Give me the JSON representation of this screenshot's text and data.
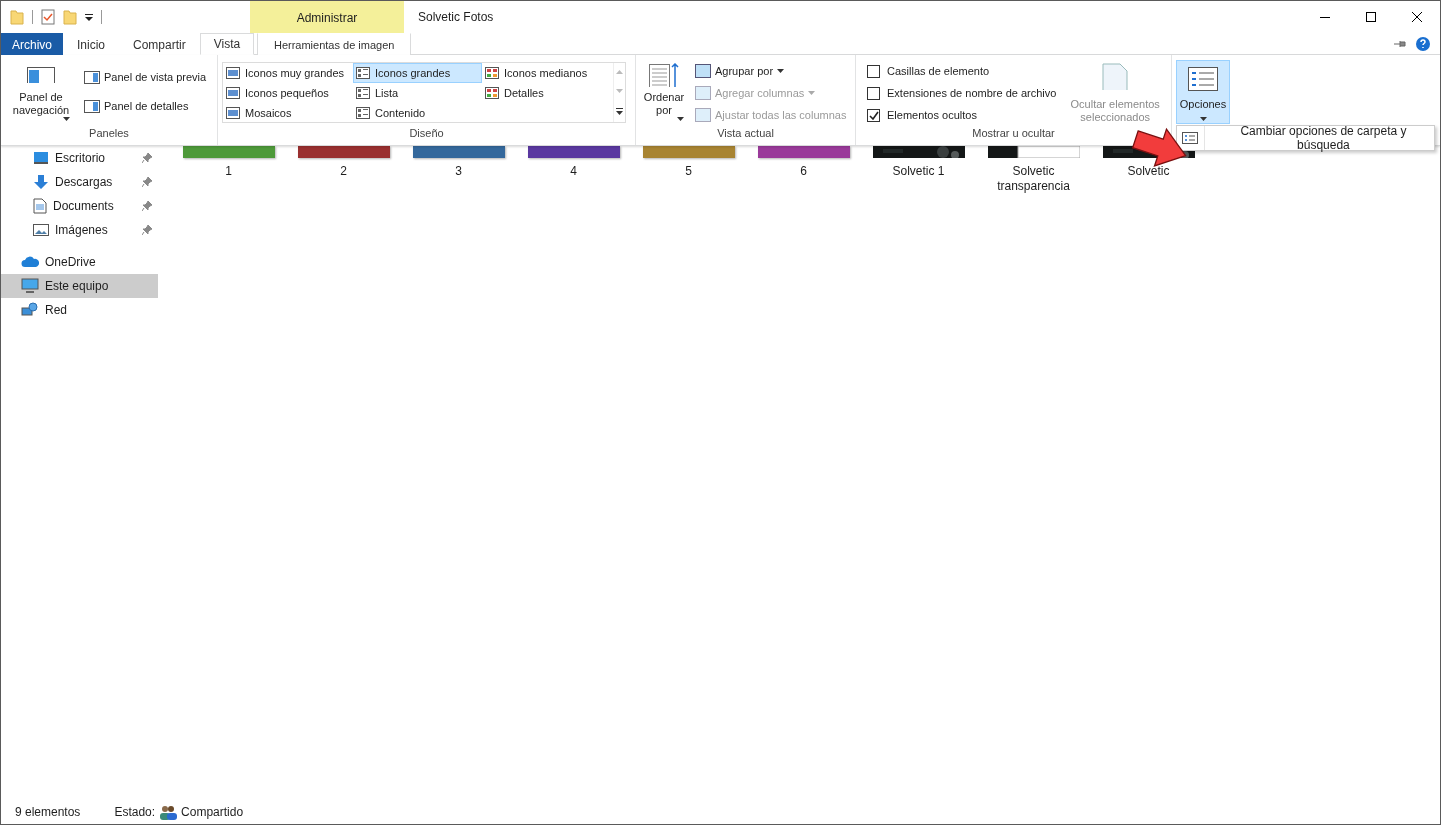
{
  "window": {
    "title": "Solvetic Fotos"
  },
  "contextual": {
    "group": "Administrar",
    "tab": {
      "label": "Herramientas de imagen",
      "selected": false
    }
  },
  "tabs": [
    {
      "label": "Archivo",
      "kind": "file",
      "selected": false
    },
    {
      "label": "Inicio",
      "kind": "tab",
      "selected": false
    },
    {
      "label": "Compartir",
      "kind": "tab",
      "selected": false
    },
    {
      "label": "Vista",
      "kind": "tab",
      "selected": true
    }
  ],
  "ribbon": {
    "panes": {
      "label": "Paneles",
      "large": "Panel de navegación",
      "items": [
        "Panel de vista previa",
        "Panel de detalles"
      ]
    },
    "layout": {
      "label": "Diseño",
      "options": [
        {
          "label": "Iconos muy grandes",
          "selected": false
        },
        {
          "label": "Iconos grandes",
          "selected": true
        },
        {
          "label": "Iconos medianos",
          "selected": false
        },
        {
          "label": "Iconos pequeños",
          "selected": false
        },
        {
          "label": "Lista",
          "selected": false
        },
        {
          "label": "Detalles",
          "selected": false
        },
        {
          "label": "Mosaicos",
          "selected": false
        },
        {
          "label": "Contenido",
          "selected": false
        }
      ]
    },
    "current_view": {
      "label": "Vista actual",
      "sort": "Ordenar por",
      "items": [
        {
          "label": "Agrupar por",
          "disabled": false,
          "dropdown": true
        },
        {
          "label": "Agregar columnas",
          "disabled": true,
          "dropdown": true
        },
        {
          "label": "Ajustar todas las columnas",
          "disabled": true,
          "dropdown": false
        }
      ]
    },
    "show_hide": {
      "label": "Mostrar u ocultar",
      "checkboxes": [
        {
          "label": "Casillas de elemento",
          "checked": false
        },
        {
          "label": "Extensiones de nombre de archivo",
          "checked": false
        },
        {
          "label": "Elementos ocultos",
          "checked": true
        }
      ],
      "hide_selected": {
        "label": "Ocultar elementos seleccionados",
        "disabled": true
      }
    },
    "options": {
      "label": "Opciones",
      "expanded": true
    }
  },
  "menu": {
    "items": [
      "Cambiar opciones de carpeta y búsqueda"
    ]
  },
  "nav": [
    {
      "label": "Escritorio",
      "kind": "desktop",
      "pinned": true,
      "selected": false
    },
    {
      "label": "Descargas",
      "kind": "download",
      "pinned": true,
      "selected": false
    },
    {
      "label": "Documents",
      "kind": "document",
      "pinned": true,
      "selected": false
    },
    {
      "label": "Imágenes",
      "kind": "pictures",
      "pinned": true,
      "selected": false
    },
    {
      "label": "OneDrive",
      "kind": "cloud",
      "pinned": false,
      "selected": false
    },
    {
      "label": "Este equipo",
      "kind": "computer",
      "pinned": false,
      "selected": true
    },
    {
      "label": "Red",
      "kind": "network",
      "pinned": false,
      "selected": false
    }
  ],
  "files": [
    {
      "name": "1",
      "kind": "color",
      "color": "#4e9a3a"
    },
    {
      "name": "2",
      "kind": "color",
      "color": "#9a3030"
    },
    {
      "name": "3",
      "kind": "color",
      "color": "#34689c"
    },
    {
      "name": "4",
      "kind": "color",
      "color": "#5a38a0"
    },
    {
      "name": "5",
      "kind": "color",
      "color": "#a88432"
    },
    {
      "name": "6",
      "kind": "color",
      "color": "#9a3a9a"
    },
    {
      "name": "Solvetic 1",
      "kind": "picture"
    },
    {
      "name": "Solvetic transparencia",
      "kind": "transparent"
    },
    {
      "name": "Solvetic",
      "kind": "picture"
    }
  ],
  "status_bar": {
    "count": "9 elementos",
    "state_label": "Estado:",
    "state": "Compartido"
  }
}
